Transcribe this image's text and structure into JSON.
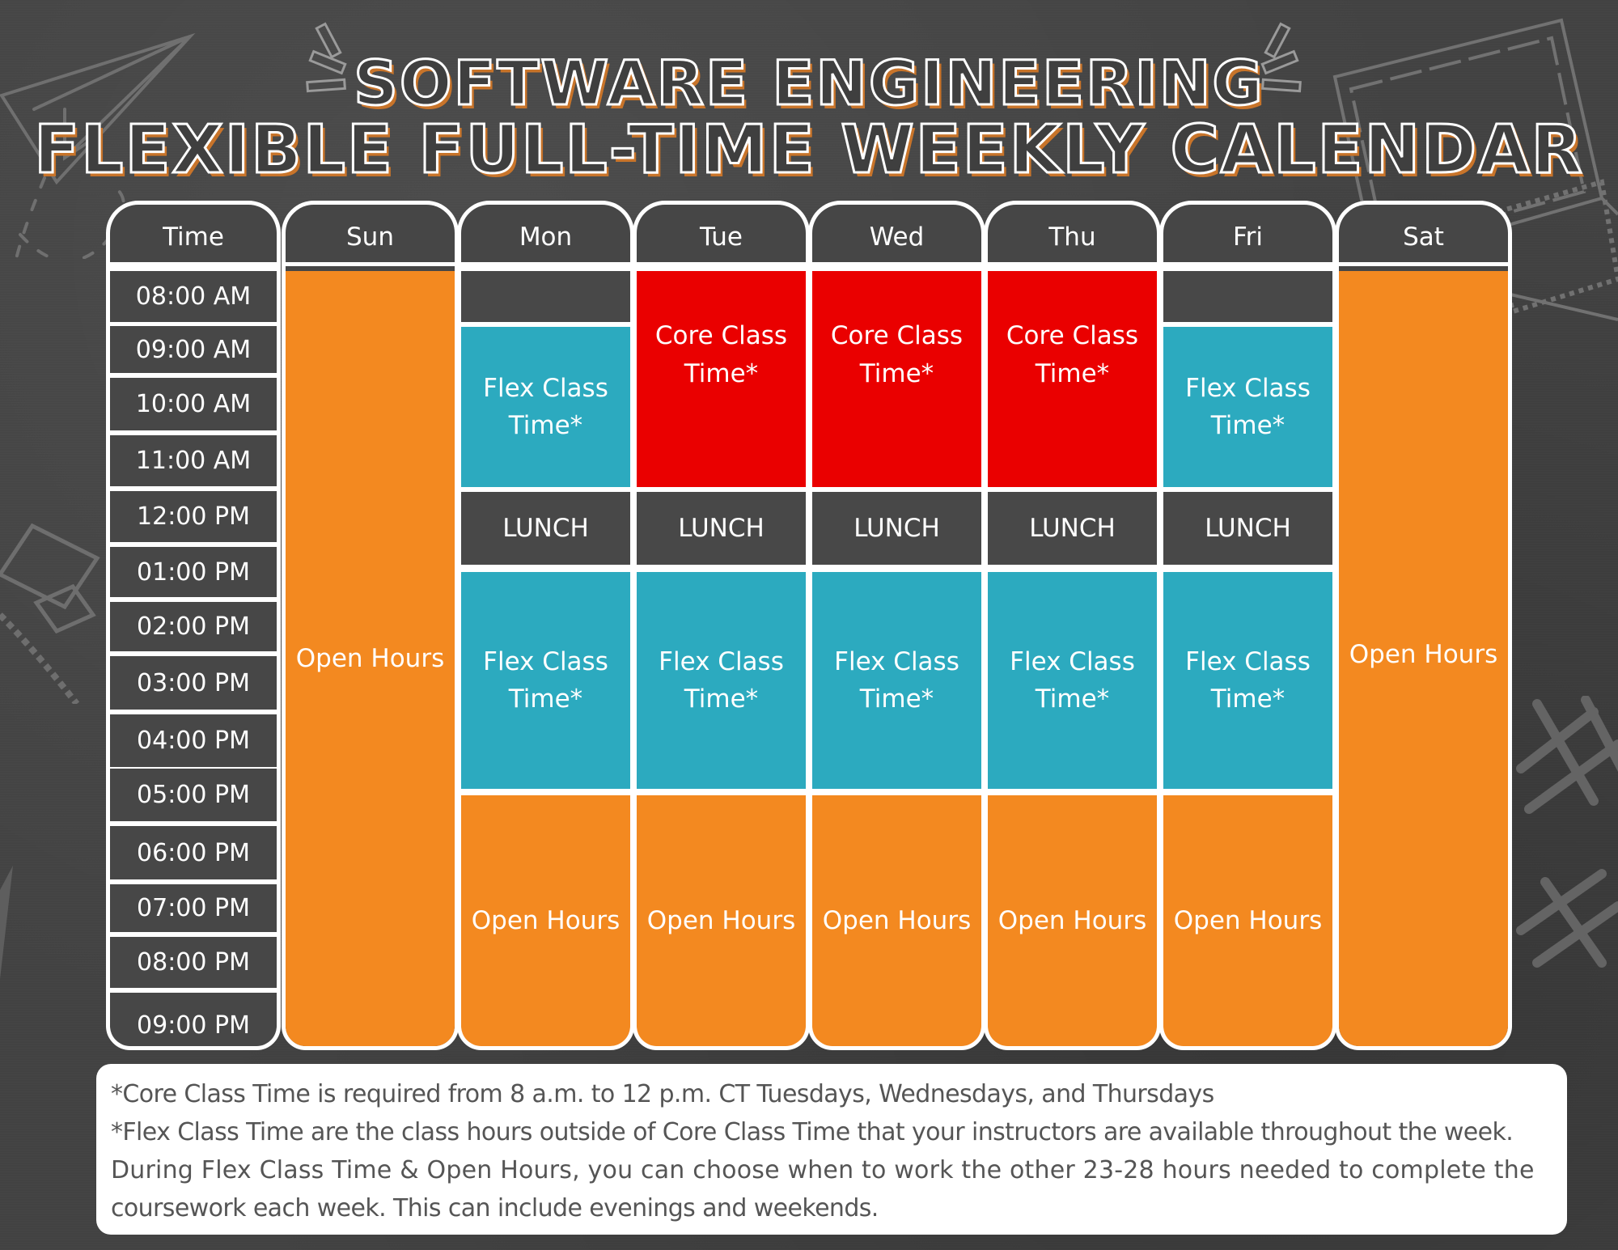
{
  "title": {
    "line1": "SOFTWARE ENGINEERING",
    "line2": "FLEXIBLE FULL-TIME WEEKLY CALENDAR"
  },
  "colors": {
    "core": "#ea0000",
    "flex": "#2caabf",
    "open": "#f38920",
    "background": "#424242",
    "border": "#ffffff"
  },
  "time_column": {
    "header": "Time",
    "rows": [
      "08:00 AM",
      "09:00 AM",
      "10:00 AM",
      "11:00 AM",
      "12:00 PM",
      "01:00 PM",
      "02:00 PM",
      "03:00 PM",
      "04:00 PM",
      "05:00 PM",
      "06:00 PM",
      "07:00 PM",
      "08:00 PM",
      "09:00 PM"
    ]
  },
  "days": [
    {
      "name": "Sun",
      "blocks": [
        {
          "type": "open",
          "label": "Open Hours",
          "start": "08:00 AM",
          "end": "10:00 PM"
        }
      ]
    },
    {
      "name": "Mon",
      "blocks": [
        {
          "type": "empty",
          "label": "",
          "start": "08:00 AM",
          "end": "09:00 AM"
        },
        {
          "type": "flex",
          "label": "Flex Class Time*",
          "start": "09:00 AM",
          "end": "12:00 PM"
        },
        {
          "type": "lunch",
          "label": "LUNCH",
          "start": "12:00 PM",
          "end": "01:00 PM"
        },
        {
          "type": "flex",
          "label": "Flex Class Time*",
          "start": "01:00 PM",
          "end": "04:00 PM"
        },
        {
          "type": "open",
          "label": "Open Hours",
          "start": "04:00 PM",
          "end": "10:00 PM"
        }
      ]
    },
    {
      "name": "Tue",
      "blocks": [
        {
          "type": "core",
          "label": "Core Class Time*",
          "start": "08:00 AM",
          "end": "12:00 PM"
        },
        {
          "type": "lunch",
          "label": "LUNCH",
          "start": "12:00 PM",
          "end": "01:00 PM"
        },
        {
          "type": "flex",
          "label": "Flex Class Time*",
          "start": "01:00 PM",
          "end": "04:00 PM"
        },
        {
          "type": "open",
          "label": "Open Hours",
          "start": "04:00 PM",
          "end": "10:00 PM"
        }
      ]
    },
    {
      "name": "Wed",
      "blocks": [
        {
          "type": "core",
          "label": "Core Class Time*",
          "start": "08:00 AM",
          "end": "12:00 PM"
        },
        {
          "type": "lunch",
          "label": "LUNCH",
          "start": "12:00 PM",
          "end": "01:00 PM"
        },
        {
          "type": "flex",
          "label": "Flex Class Time*",
          "start": "01:00 PM",
          "end": "04:00 PM"
        },
        {
          "type": "open",
          "label": "Open Hours",
          "start": "04:00 PM",
          "end": "10:00 PM"
        }
      ]
    },
    {
      "name": "Thu",
      "blocks": [
        {
          "type": "core",
          "label": "Core Class Time*",
          "start": "08:00 AM",
          "end": "12:00 PM"
        },
        {
          "type": "lunch",
          "label": "LUNCH",
          "start": "12:00 PM",
          "end": "01:00 PM"
        },
        {
          "type": "flex",
          "label": "Flex Class Time*",
          "start": "01:00 PM",
          "end": "04:00 PM"
        },
        {
          "type": "open",
          "label": "Open Hours",
          "start": "04:00 PM",
          "end": "10:00 PM"
        }
      ]
    },
    {
      "name": "Fri",
      "blocks": [
        {
          "type": "empty",
          "label": "",
          "start": "08:00 AM",
          "end": "09:00 AM"
        },
        {
          "type": "flex",
          "label": "Flex Class Time*",
          "start": "09:00 AM",
          "end": "12:00 PM"
        },
        {
          "type": "lunch",
          "label": "LUNCH",
          "start": "12:00 PM",
          "end": "01:00 PM"
        },
        {
          "type": "flex",
          "label": "Flex Class Time*",
          "start": "01:00 PM",
          "end": "04:00 PM"
        },
        {
          "type": "open",
          "label": "Open Hours",
          "start": "04:00 PM",
          "end": "10:00 PM"
        }
      ]
    },
    {
      "name": "Sat",
      "blocks": [
        {
          "type": "open",
          "label": "Open Hours",
          "start": "08:00 AM",
          "end": "10:00 PM"
        }
      ]
    }
  ],
  "footnote": {
    "lines": [
      "*Core Class Time is required from 8 a.m. to 12 p.m. CT Tuesdays, Wednesdays, and Thursdays",
      "*Flex Class Time are the class hours outside of Core Class Time that your instructors are available throughout the week.",
      "During Flex Class Time & Open Hours, you can choose when to work the other 23-28 hours needed to complete the",
      "coursework each week. This can include evenings and weekends."
    ]
  }
}
